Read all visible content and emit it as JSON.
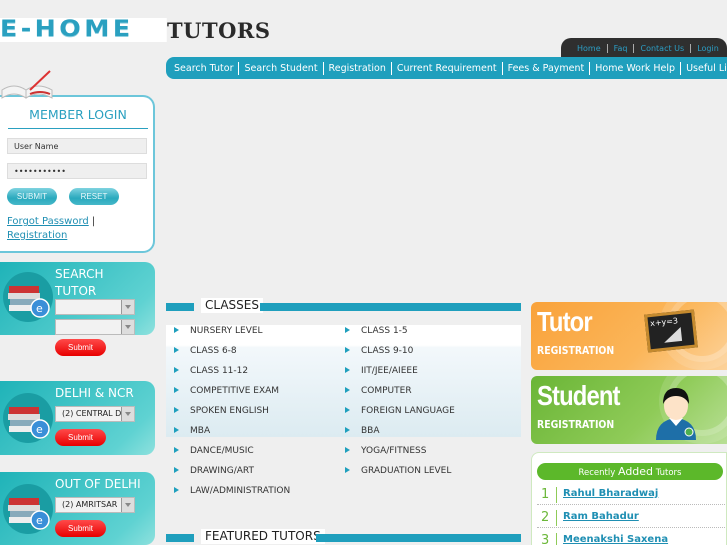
{
  "brand": {
    "part1": "E-HOME",
    "part2": "TUTORS"
  },
  "top_links": [
    "Home",
    "Faq",
    "Contact Us",
    "Login"
  ],
  "main_nav": [
    "Search Tutor",
    "Search Student",
    "Registration",
    "Current Requirement",
    "Fees & Payment",
    "Home Work Help",
    "Useful Links"
  ],
  "login": {
    "title": "MEMBER LOGIN",
    "username_value": "User Name",
    "password_value": "•••••••••••",
    "submit_label": "SUBMIT",
    "reset_label": "RESET",
    "forgot_label": "Forgot Password",
    "separator": "|",
    "registration_label": "Registration"
  },
  "search_tutor": {
    "title_line1": "SEARCH",
    "title_line2": "TUTOR",
    "select1_value": "",
    "select2_value": "",
    "submit_label": "Submit"
  },
  "delhi_ncr": {
    "title": "DELHI & NCR",
    "select_value": "(2) CENTRAL D",
    "submit_label": "Submit"
  },
  "out_of_delhi": {
    "title": "OUT OF DELHI",
    "select_value": "(2) AMRITSAR",
    "submit_label": "Submit"
  },
  "classes": {
    "title": "CLASSES",
    "left": [
      "NURSERY LEVEL",
      "CLASS 6-8",
      "CLASS 11-12",
      "COMPETITIVE EXAM",
      "SPOKEN ENGLISH",
      "MBA",
      "DANCE/MUSIC",
      "DRAWING/ART",
      "LAW/ADMINISTRATION"
    ],
    "right": [
      "CLASS 1-5",
      "CLASS 9-10",
      "IIT/JEE/AIEEE",
      "COMPUTER",
      "FOREIGN LANGUAGE",
      "BBA",
      "YOGA/FITNESS",
      "GRADUATION LEVEL"
    ]
  },
  "featured": {
    "title": "FEATURED TUTORS"
  },
  "banners": {
    "tutor": {
      "big": "Tutor",
      "small": "REGISTRATION",
      "board_text": "x+y=3"
    },
    "student": {
      "big": "Student",
      "small": "REGISTRATION"
    }
  },
  "recent": {
    "head_small1": "Recently",
    "head_big": "Added",
    "head_small2": "Tutors",
    "items": [
      {
        "num": "1",
        "name": "Rahul Bharadwaj"
      },
      {
        "num": "2",
        "name": "Ram Bahadur"
      },
      {
        "num": "3",
        "name": "Meenakshi Saxena"
      }
    ]
  },
  "colors": {
    "primary_teal": "#1f9fbd",
    "dark_tab": "#2f2f2f",
    "submit_red": "#e80000",
    "tutor_orange": "#f9a23a",
    "student_green": "#6ab536"
  }
}
